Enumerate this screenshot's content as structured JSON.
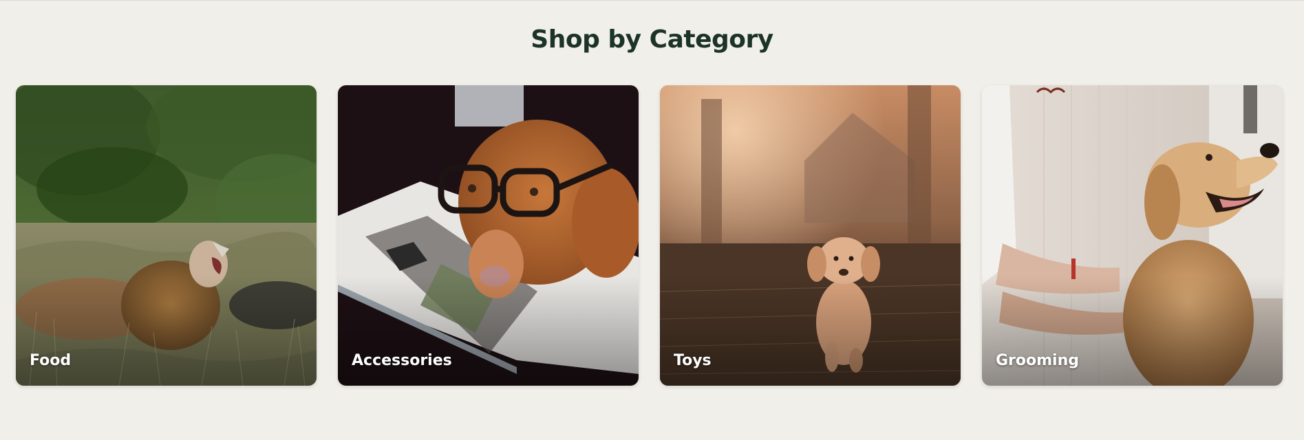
{
  "section": {
    "title": "Shop by Category"
  },
  "categories": [
    {
      "label": "Food",
      "image": "lion-roaring-in-grass"
    },
    {
      "label": "Accessories",
      "image": "dog-with-glasses-on-magazine"
    },
    {
      "label": "Toys",
      "image": "puppy-running-at-sunset"
    },
    {
      "label": "Grooming",
      "image": "golden-retriever-being-groomed"
    }
  ],
  "colors": {
    "background": "#f1efe9",
    "title": "#1c3328",
    "label": "#ffffff"
  }
}
